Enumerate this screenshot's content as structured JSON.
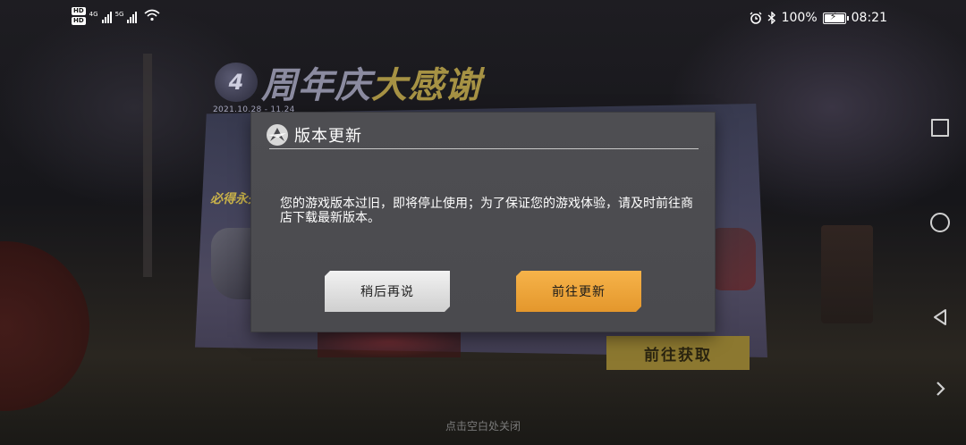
{
  "status_bar": {
    "network_top": "4G",
    "network_bottom": "5G",
    "hd_label": "HD",
    "battery": "100%",
    "time": "08:21",
    "icons": [
      "alarm-icon",
      "bluetooth-icon",
      "battery-charging-icon",
      "wifi-icon",
      "signal-icon"
    ]
  },
  "background": {
    "event_logo": "4",
    "event_title_a": "周年庆",
    "event_title_b": "大感谢",
    "event_date": "2021.10.28 - 11.24",
    "banner_tag": "必得永久",
    "get_button": "前往获取",
    "close_hint": "点击空白处关闭"
  },
  "dialog": {
    "title": "版本更新",
    "message": "您的游戏版本过旧，即将停止使用；为了保证您的游戏体验，请及时前往商店下载最新版本。",
    "later_button": "稍后再说",
    "update_button": "前往更新",
    "colors": {
      "update_button": "#f0a63c",
      "later_button": "#e6e6e6"
    }
  },
  "navbar": {
    "buttons": [
      "recents-square-icon",
      "home-circle-icon",
      "back-triangle-icon",
      "expand-arrow-icon"
    ]
  }
}
